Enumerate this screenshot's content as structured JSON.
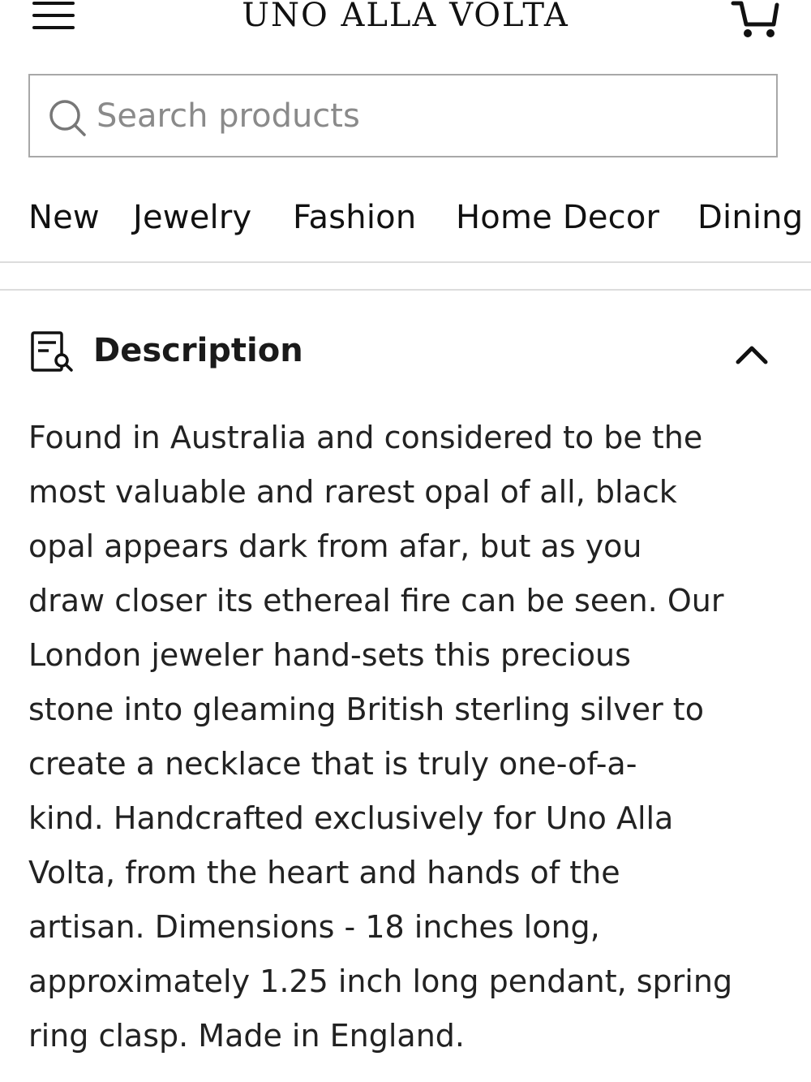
{
  "header": {
    "brand": "UNO ALLA VOLTA",
    "menu_icon": "hamburger-menu-icon",
    "cart_icon": "shopping-cart-icon"
  },
  "search": {
    "placeholder": "Search products",
    "value": "",
    "icon": "search-icon"
  },
  "nav": {
    "items": [
      {
        "label": "New"
      },
      {
        "label": "Jewelry"
      },
      {
        "label": "Fashion"
      },
      {
        "label": "Home Decor"
      },
      {
        "label": "Dining"
      }
    ]
  },
  "description": {
    "icon": "document-search-icon",
    "title": "Description",
    "expanded_icon": "chevron-up-icon",
    "lines": [
      "Found in Australia and considered to be the",
      "most valuable and rarest opal of all, black",
      "opal appears dark from afar, but as you",
      "draw closer its ethereal fire can be seen. Our",
      "London jeweler hand-sets this precious",
      "stone into gleaming British sterling silver to",
      "create a necklace that is truly one-of-a-",
      "kind. Handcrafted exclusively for Uno Alla",
      "Volta, from the heart and hands of the",
      "artisan. Dimensions - 18 inches long,",
      "approximately 1.25 inch long pendant, spring",
      "ring clasp. Made in England."
    ]
  },
  "colors": {
    "text": "#1a1a1a",
    "border": "#a8a8a8",
    "divider": "#dcdcdc",
    "placeholder": "#8a8a8a"
  }
}
